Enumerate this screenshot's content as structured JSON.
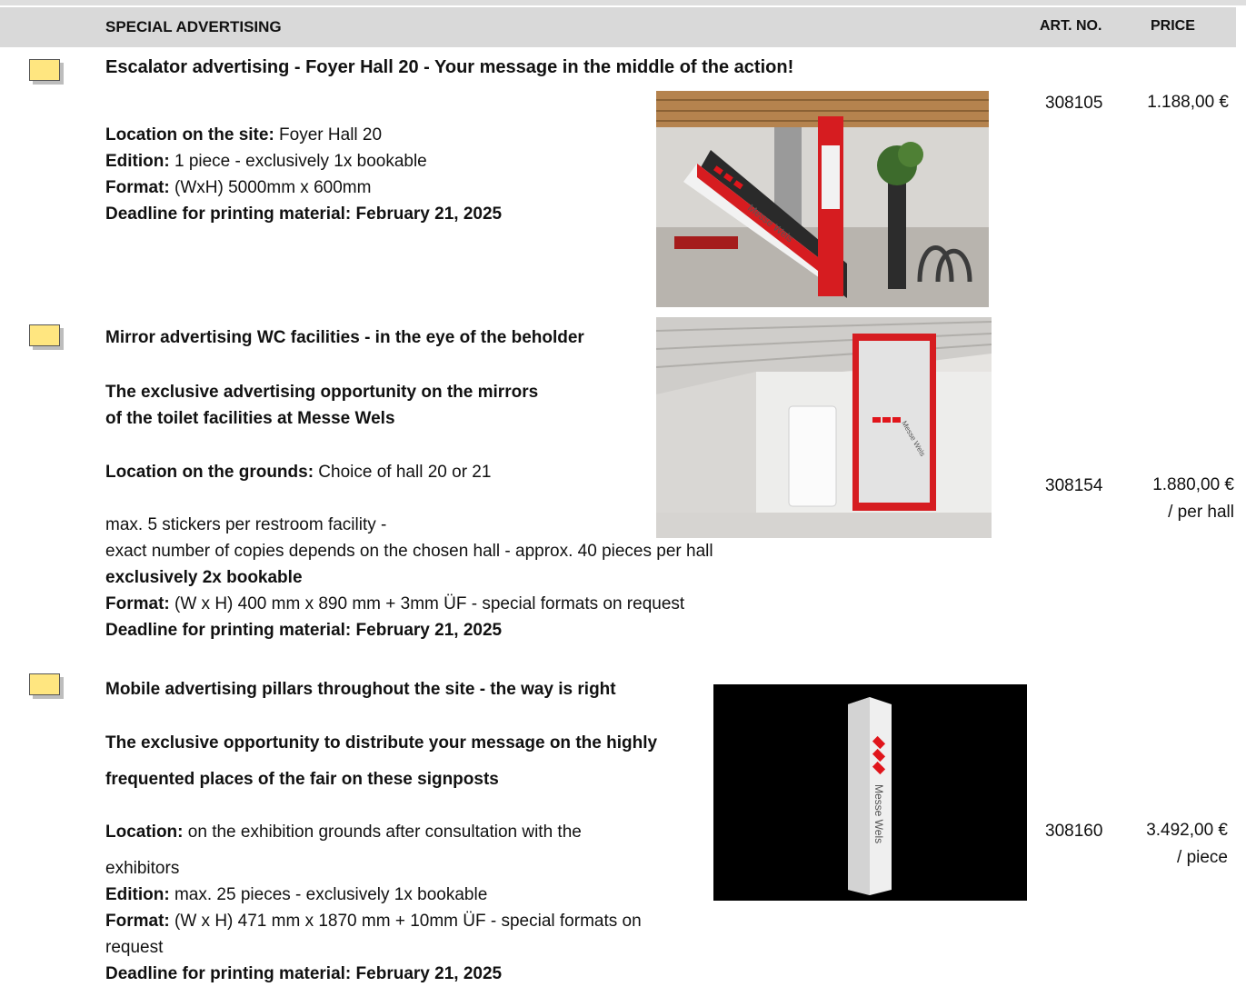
{
  "header": {
    "title": "SPECIAL ADVERTISING",
    "art_no_label": "ART. NO.",
    "price_label": "PRICE"
  },
  "items": [
    {
      "title": "Escalator advertising - Foyer Hall 20 - Your message in the middle of the action!",
      "location_label": "Location on the site:",
      "location_value": " Foyer Hall 20",
      "edition_label": "Edition:",
      "edition_value": " 1 piece - exclusively 1x bookable",
      "format_label": "Format:",
      "format_value": " (WxH) 5000mm x 600mm",
      "deadline": "Deadline for printing material: February 21, 2025",
      "art_no": "308105",
      "price": "1.188,00 €",
      "image_caption": "Messe Wels"
    },
    {
      "title": "Mirror advertising WC facilities - in the eye of the beholder",
      "subtitle_1": "The exclusive advertising opportunity on the mirrors",
      "subtitle_2": "of the toilet facilities at Messe Wels",
      "location_label": "Location on the grounds:",
      "location_value": " Choice of hall 20 or 21",
      "note_1": "max. 5 stickers per restroom facility -",
      "note_2": "exact number of copies depends on the chosen hall - approx. 40 pieces per hall",
      "exclusive": "exclusively 2x bookable",
      "format_label": "Format:",
      "format_value": " (W x H) 400 mm x 890 mm + 3mm ÜF - special formats on request",
      "deadline": "Deadline for printing material: February 21, 2025",
      "art_no": "308154",
      "price": "1.880,00 €",
      "price_unit": "/ per hall",
      "image_caption": "Messe Wels"
    },
    {
      "title": "Mobile advertising pillars throughout the site - the way is right",
      "subtitle_1": "The exclusive opportunity to distribute your message on the highly",
      "subtitle_2": "frequented places of the fair on these signposts",
      "location_label": "Location:",
      "location_value": " on the exhibition grounds after consultation with the",
      "location_value_2": "exhibitors",
      "edition_label": "Edition:",
      "edition_value": " max. 25 pieces - exclusively 1x bookable",
      "format_label": "Format:",
      "format_value": " (W x H) 471 mm x 1870 mm + 10mm ÜF - special formats on",
      "format_value_2": "request",
      "deadline": "Deadline for printing material: February 21, 2025",
      "art_no": "308160",
      "price": "3.492,00 €",
      "price_unit": "/ piece",
      "image_caption": "Messe Wels"
    }
  ],
  "colors": {
    "header_bg": "#d9d9d9",
    "checkbox_fill": "#ffe680",
    "brand_red": "#e0151b"
  }
}
